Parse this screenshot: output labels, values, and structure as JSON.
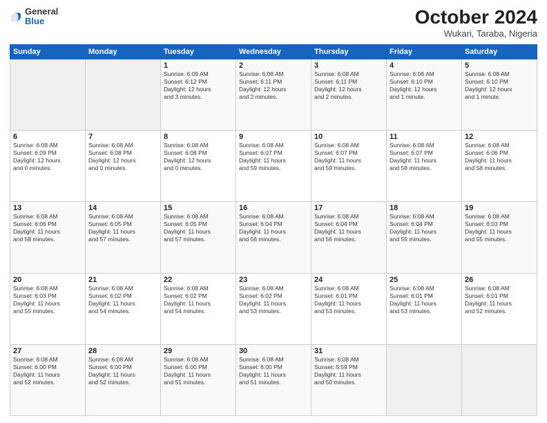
{
  "header": {
    "logo": {
      "general": "General",
      "blue": "Blue"
    },
    "title": "October 2024",
    "location": "Wukari, Taraba, Nigeria"
  },
  "calendar": {
    "days_of_week": [
      "Sunday",
      "Monday",
      "Tuesday",
      "Wednesday",
      "Thursday",
      "Friday",
      "Saturday"
    ],
    "weeks": [
      [
        {
          "day": "",
          "info": ""
        },
        {
          "day": "",
          "info": ""
        },
        {
          "day": "1",
          "info": "Sunrise: 6:09 AM\nSunset: 6:12 PM\nDaylight: 12 hours\nand 3 minutes."
        },
        {
          "day": "2",
          "info": "Sunrise: 6:08 AM\nSunset: 6:11 PM\nDaylight: 12 hours\nand 2 minutes."
        },
        {
          "day": "3",
          "info": "Sunrise: 6:08 AM\nSunset: 6:11 PM\nDaylight: 12 hours\nand 2 minutes."
        },
        {
          "day": "4",
          "info": "Sunrise: 6:08 AM\nSunset: 6:10 PM\nDaylight: 12 hours\nand 1 minute."
        },
        {
          "day": "5",
          "info": "Sunrise: 6:08 AM\nSunset: 6:10 PM\nDaylight: 12 hours\nand 1 minute."
        }
      ],
      [
        {
          "day": "6",
          "info": "Sunrise: 6:08 AM\nSunset: 6:09 PM\nDaylight: 12 hours\nand 0 minutes."
        },
        {
          "day": "7",
          "info": "Sunrise: 6:08 AM\nSunset: 6:08 PM\nDaylight: 12 hours\nand 0 minutes."
        },
        {
          "day": "8",
          "info": "Sunrise: 6:08 AM\nSunset: 6:08 PM\nDaylight: 12 hours\nand 0 minutes."
        },
        {
          "day": "9",
          "info": "Sunrise: 6:08 AM\nSunset: 6:07 PM\nDaylight: 11 hours\nand 59 minutes."
        },
        {
          "day": "10",
          "info": "Sunrise: 6:08 AM\nSunset: 6:07 PM\nDaylight: 11 hours\nand 59 minutes."
        },
        {
          "day": "11",
          "info": "Sunrise: 6:08 AM\nSunset: 6:07 PM\nDaylight: 11 hours\nand 58 minutes."
        },
        {
          "day": "12",
          "info": "Sunrise: 6:08 AM\nSunset: 6:06 PM\nDaylight: 11 hours\nand 58 minutes."
        }
      ],
      [
        {
          "day": "13",
          "info": "Sunrise: 6:08 AM\nSunset: 6:06 PM\nDaylight: 11 hours\nand 58 minutes."
        },
        {
          "day": "14",
          "info": "Sunrise: 6:08 AM\nSunset: 6:05 PM\nDaylight: 11 hours\nand 57 minutes."
        },
        {
          "day": "15",
          "info": "Sunrise: 6:08 AM\nSunset: 6:05 PM\nDaylight: 11 hours\nand 57 minutes."
        },
        {
          "day": "16",
          "info": "Sunrise: 6:08 AM\nSunset: 6:04 PM\nDaylight: 11 hours\nand 56 minutes."
        },
        {
          "day": "17",
          "info": "Sunrise: 6:08 AM\nSunset: 6:04 PM\nDaylight: 11 hours\nand 56 minutes."
        },
        {
          "day": "18",
          "info": "Sunrise: 6:08 AM\nSunset: 6:04 PM\nDaylight: 11 hours\nand 55 minutes."
        },
        {
          "day": "19",
          "info": "Sunrise: 6:08 AM\nSunset: 6:03 PM\nDaylight: 11 hours\nand 55 minutes."
        }
      ],
      [
        {
          "day": "20",
          "info": "Sunrise: 6:08 AM\nSunset: 6:03 PM\nDaylight: 11 hours\nand 55 minutes."
        },
        {
          "day": "21",
          "info": "Sunrise: 6:08 AM\nSunset: 6:02 PM\nDaylight: 11 hours\nand 54 minutes."
        },
        {
          "day": "22",
          "info": "Sunrise: 6:08 AM\nSunset: 6:02 PM\nDaylight: 11 hours\nand 54 minutes."
        },
        {
          "day": "23",
          "info": "Sunrise: 6:08 AM\nSunset: 6:02 PM\nDaylight: 11 hours\nand 53 minutes."
        },
        {
          "day": "24",
          "info": "Sunrise: 6:08 AM\nSunset: 6:01 PM\nDaylight: 11 hours\nand 53 minutes."
        },
        {
          "day": "25",
          "info": "Sunrise: 6:08 AM\nSunset: 6:01 PM\nDaylight: 11 hours\nand 53 minutes."
        },
        {
          "day": "26",
          "info": "Sunrise: 6:08 AM\nSunset: 6:01 PM\nDaylight: 11 hours\nand 52 minutes."
        }
      ],
      [
        {
          "day": "27",
          "info": "Sunrise: 6:08 AM\nSunset: 6:00 PM\nDaylight: 11 hours\nand 52 minutes."
        },
        {
          "day": "28",
          "info": "Sunrise: 6:08 AM\nSunset: 6:00 PM\nDaylight: 11 hours\nand 52 minutes."
        },
        {
          "day": "29",
          "info": "Sunrise: 6:08 AM\nSunset: 6:00 PM\nDaylight: 11 hours\nand 51 minutes."
        },
        {
          "day": "30",
          "info": "Sunrise: 6:08 AM\nSunset: 6:00 PM\nDaylight: 11 hours\nand 51 minutes."
        },
        {
          "day": "31",
          "info": "Sunrise: 6:08 AM\nSunset: 5:59 PM\nDaylight: 11 hours\nand 50 minutes."
        },
        {
          "day": "",
          "info": ""
        },
        {
          "day": "",
          "info": ""
        }
      ]
    ]
  }
}
